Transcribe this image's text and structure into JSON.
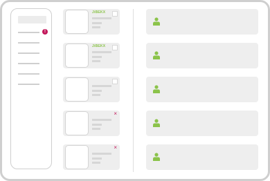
{
  "colors": {
    "accent_green": "#8bc34a",
    "alert": "#c2185b",
    "frame": "#cfcfcf"
  },
  "sidebar": {
    "notification_count": "!",
    "items": [
      "",
      "",
      "",
      "",
      "",
      ""
    ]
  },
  "files": [
    {
      "tag": "JiBEKX",
      "marker": "checkbox"
    },
    {
      "tag": "JiBEKX",
      "marker": "checkbox"
    },
    {
      "tag": "",
      "marker": "checkbox"
    },
    {
      "tag": "",
      "marker": "remove",
      "remove_glyph": "×"
    },
    {
      "tag": "",
      "marker": "remove",
      "remove_glyph": "×"
    }
  ],
  "users": [
    {
      "icon": "person-icon"
    },
    {
      "icon": "person-icon"
    },
    {
      "icon": "person-icon"
    },
    {
      "icon": "person-icon"
    },
    {
      "icon": "person-icon"
    }
  ]
}
